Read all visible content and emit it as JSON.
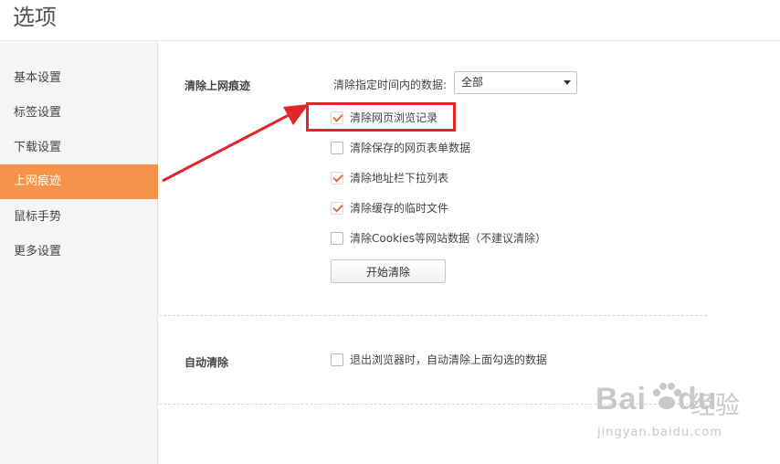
{
  "window": {
    "title": "选项"
  },
  "sidebar": {
    "items": [
      {
        "label": "基本设置",
        "active": false
      },
      {
        "label": "标签设置",
        "active": false
      },
      {
        "label": "下载设置",
        "active": false
      },
      {
        "label": "上网痕迹",
        "active": true
      },
      {
        "label": "鼠标手势",
        "active": false
      },
      {
        "label": "更多设置",
        "active": false
      }
    ]
  },
  "clear_section": {
    "title": "清除上网痕迹",
    "range_label": "清除指定时间内的数据:",
    "range_value": "全部",
    "options": [
      {
        "label": "清除网页浏览记录",
        "checked": true
      },
      {
        "label": "清除保存的网页表单数据",
        "checked": false
      },
      {
        "label": "清除地址栏下拉列表",
        "checked": true
      },
      {
        "label": "清除缓存的临时文件",
        "checked": true
      },
      {
        "label": "清除Cookies等网站数据（不建议清除）",
        "checked": false
      }
    ],
    "start_button": "开始清除"
  },
  "auto_section": {
    "title": "自动清除",
    "option": {
      "label": "退出浏览器时，自动清除上面勾选的数据",
      "checked": false
    }
  },
  "watermark": {
    "logo_text": "Bai",
    "logo_text_2": "du",
    "brand": "经验",
    "url": "jingyan.baidu.com"
  },
  "colors": {
    "accent": "#f6934a",
    "check": "#f06a2b",
    "annotation": "#e0262b"
  }
}
